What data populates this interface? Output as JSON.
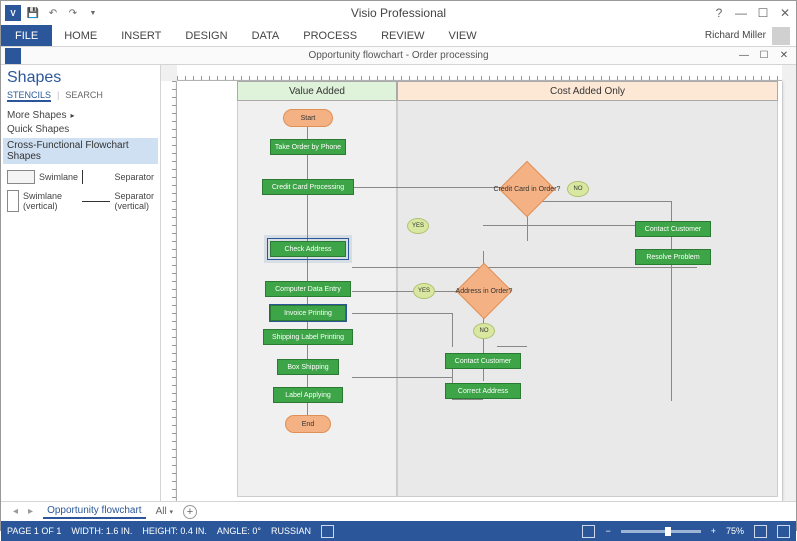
{
  "app": {
    "title": "Visio Professional",
    "user": "Richard Miller"
  },
  "ribbon": {
    "file": "FILE",
    "tabs": [
      "HOME",
      "INSERT",
      "DESIGN",
      "DATA",
      "PROCESS",
      "REVIEW",
      "VIEW"
    ]
  },
  "document": {
    "title": "Opportunity flowchart - Order processing"
  },
  "shapes_panel": {
    "title": "Shapes",
    "tabs": {
      "stencils": "STENCILS",
      "search": "SEARCH"
    },
    "more_shapes": "More Shapes",
    "quick_shapes": "Quick Shapes",
    "active_stencil": "Cross-Functional Flowchart Shapes",
    "shapes": {
      "swimlane": "Swimlane",
      "separator": "Separator",
      "swimlane_v": "Swimlane (vertical)",
      "separator_v": "Separator (vertical)"
    }
  },
  "lanes": {
    "value_added": "Value Added",
    "cost_added": "Cost Added Only"
  },
  "nodes": {
    "start": "Start",
    "take_order": "Take Order by Phone",
    "credit_proc": "Credit Card Processing",
    "check_addr": "Check Address",
    "data_entry": "Computer Data Entry",
    "invoice": "Invoice Printing",
    "ship_label": "Shipping Label Printing",
    "box_ship": "Box Shipping",
    "label_apply": "Label Applying",
    "end": "End",
    "credit_q": "Credit Card in Order?",
    "addr_q": "Address in Order?",
    "contact1": "Contact Customer",
    "resolve": "Resolve Problem",
    "contact2": "Contact Customer",
    "correct": "Correct Address",
    "yes": "YES",
    "no": "NO"
  },
  "page_tabs": {
    "name": "Opportunity flowchart",
    "all": "All",
    "add": "+"
  },
  "status": {
    "page": "PAGE 1 OF 1",
    "width": "WIDTH: 1.6 IN.",
    "height": "HEIGHT: 0.4 IN.",
    "angle": "ANGLE: 0°",
    "lang": "RUSSIAN",
    "zoom": "75%",
    "minus": "−",
    "plus": "+"
  }
}
